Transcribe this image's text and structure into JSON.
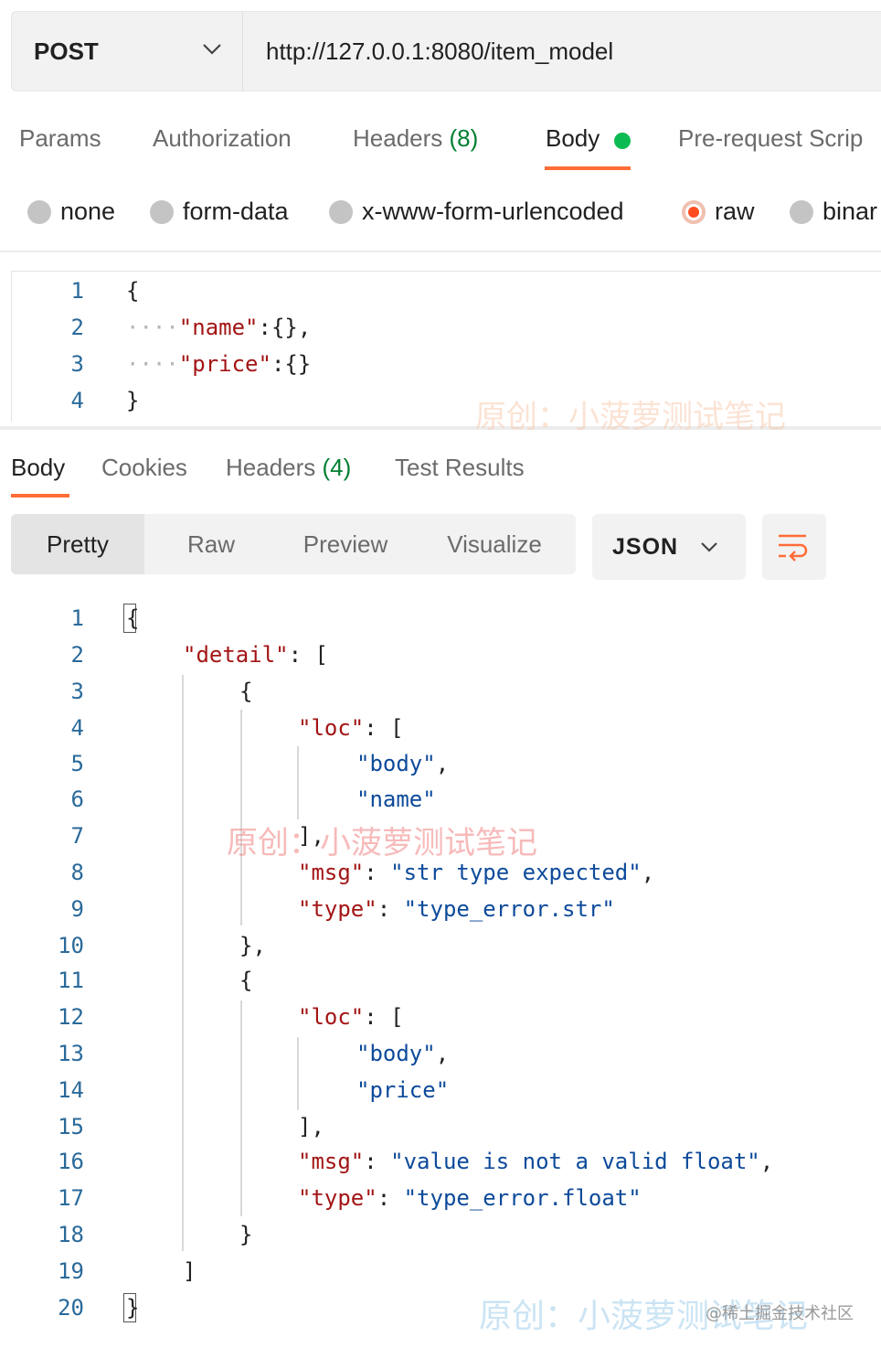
{
  "request": {
    "method": "POST",
    "url": "http://127.0.0.1:8080/item_model"
  },
  "request_tabs": {
    "params": "Params",
    "authorization": "Authorization",
    "headers": "Headers",
    "headers_count": "(8)",
    "body": "Body",
    "prerequest": "Pre-request Scrip"
  },
  "body_types": {
    "none": "none",
    "form_data": "form-data",
    "urlencoded": "x-www-form-urlencoded",
    "raw": "raw",
    "binary": "binar",
    "selected": "raw"
  },
  "request_body": {
    "line_numbers": [
      "1",
      "2",
      "3",
      "4"
    ],
    "l1": "{",
    "l2_ws": "····",
    "l2_key": "\"name\"",
    "l2_rest": ":{},",
    "l3_ws": "····",
    "l3_key": "\"price\"",
    "l3_rest": ":{}",
    "l4": "}"
  },
  "response_tabs": {
    "body": "Body",
    "cookies": "Cookies",
    "headers": "Headers",
    "headers_count": "(4)",
    "test_results": "Test Results"
  },
  "view_modes": {
    "pretty": "Pretty",
    "raw": "Raw",
    "preview": "Preview",
    "visualize": "Visualize",
    "selected": "Pretty"
  },
  "format": "JSON",
  "response_body": {
    "line_numbers": [
      "1",
      "2",
      "3",
      "4",
      "5",
      "6",
      "7",
      "8",
      "9",
      "10",
      "11",
      "12",
      "13",
      "14",
      "15",
      "16",
      "17",
      "18",
      "19",
      "20"
    ],
    "open_brace": "{",
    "detail_key": "\"detail\"",
    "colon": ":",
    "open_bracket": "[",
    "close_bracket": "]",
    "close_bracket_comma": "],",
    "obj_open": "{",
    "obj_close_comma": "},",
    "obj_close": "}",
    "close_brace": "}",
    "loc_key": "\"loc\"",
    "msg_key": "\"msg\"",
    "type_key": "\"type\"",
    "comma": ",",
    "errors": [
      {
        "loc0": "\"body\"",
        "loc1": "\"name\"",
        "msg": "\"str type expected\"",
        "type": "\"type_error.str\""
      },
      {
        "loc0": "\"body\"",
        "loc1": "\"price\"",
        "msg": "\"value is not a valid float\"",
        "type": "\"type_error.float\""
      }
    ]
  },
  "watermarks": {
    "w1": "原创：小菠萝测试笔记",
    "w2": "原创：小菠萝测试笔记",
    "w3": "原创：小菠萝测试笔记",
    "site": "@稀土掘金技术社区"
  }
}
